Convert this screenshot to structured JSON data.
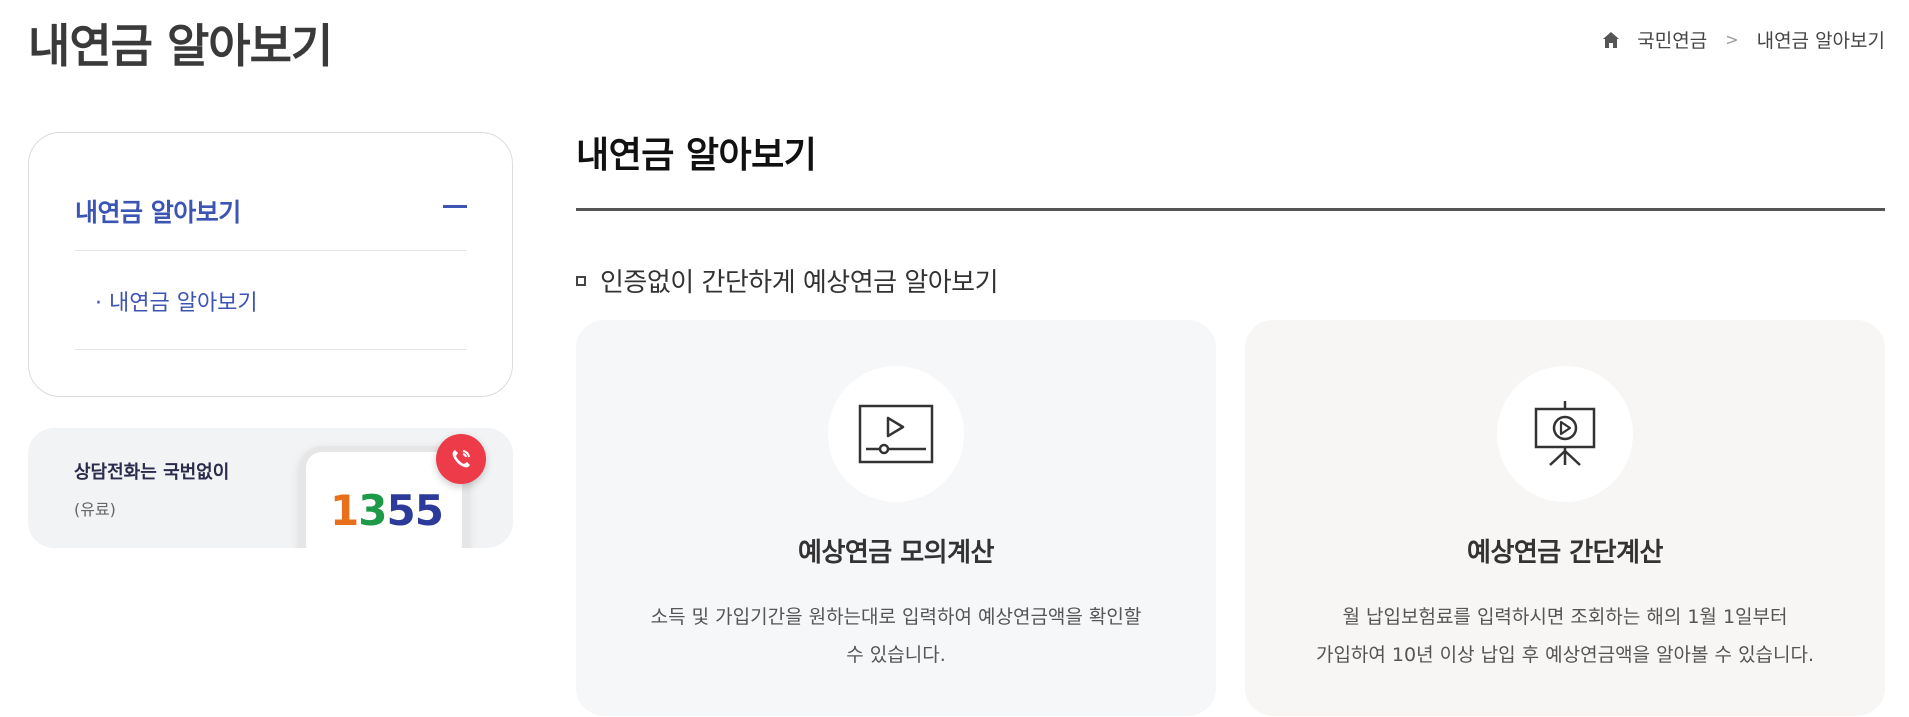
{
  "page": {
    "title": "내연금 알아보기"
  },
  "breadcrumb": {
    "items": [
      "국민연금",
      "내연금 알아보기"
    ],
    "separator": ">"
  },
  "sidebar": {
    "heading": "내연금 알아보기",
    "sub_items": [
      "· 내연금 알아보기"
    ],
    "accent": "#3c55b4"
  },
  "call_banner": {
    "text": "상담전화는 국번없이",
    "sub": "(유료)",
    "number_parts": [
      "1",
      "3",
      "5",
      "5"
    ]
  },
  "content": {
    "title": "내연금 알아보기",
    "section_title": "인증없이 간단하게 예상연금 알아보기",
    "cards": [
      {
        "icon": "video-play-icon",
        "title": "예상연금 모의계산",
        "desc_line1": "소득 및 가입기간을 원하는대로 입력하여 예상연금액을 확인할",
        "desc_line2": "수 있습니다."
      },
      {
        "icon": "presentation-play-icon",
        "title": "예상연금 간단계산",
        "desc_line1": "월 납입보험료를 입력하시면 조회하는 해의 1월 1일부터",
        "desc_line2": "가입하여 10년 이상 납입 후 예상연금액을 알아볼 수 있습니다."
      }
    ]
  }
}
